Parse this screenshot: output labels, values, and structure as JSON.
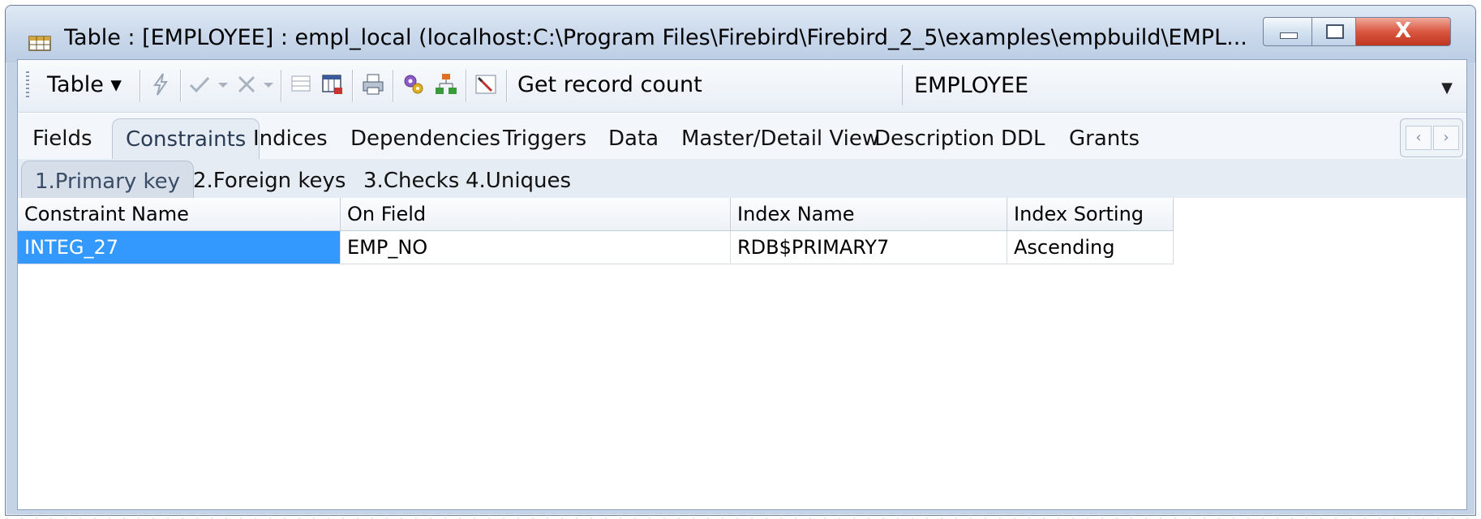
{
  "window": {
    "title": "Table : [EMPLOYEE] : empl_local (localhost:C:\\Program Files\\Firebird\\Firebird_2_5\\examples\\empbuild\\EMPL...",
    "close_glyph": "X"
  },
  "toolbar": {
    "table_menu_label": "Table ▾",
    "get_record_count_label": "Get record count",
    "object_combo_value": "EMPLOYEE"
  },
  "tabs": [
    {
      "label": "Fields"
    },
    {
      "label": "Constraints"
    },
    {
      "label": "Indices"
    },
    {
      "label": "Dependencies"
    },
    {
      "label": "Triggers"
    },
    {
      "label": "Data"
    },
    {
      "label": "Master/Detail View"
    },
    {
      "label": "Description"
    },
    {
      "label": "DDL"
    },
    {
      "label": "Grants"
    }
  ],
  "subtabs": [
    {
      "label": "1.Primary key"
    },
    {
      "label": "2.Foreign keys"
    },
    {
      "label": "3.Checks"
    },
    {
      "label": "4.Uniques"
    }
  ],
  "grid": {
    "columns": [
      "Constraint Name",
      "On Field",
      "Index Name",
      "Index Sorting"
    ],
    "rows": [
      [
        "INTEG_27",
        "EMP_NO",
        "RDB$PRIMARY7",
        "Ascending"
      ]
    ]
  },
  "colors": {
    "selection": "#3399ff",
    "titlebar": "#c7d6ea",
    "close_button": "#d9573f"
  }
}
